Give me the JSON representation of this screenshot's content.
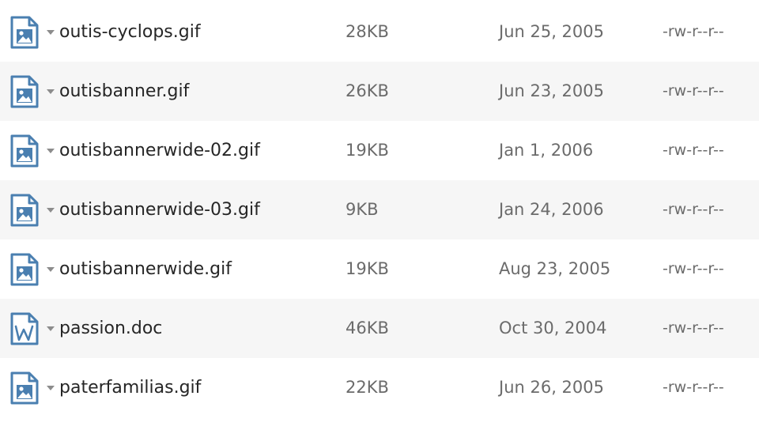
{
  "colors": {
    "icon_blue": "#4a7fb0",
    "row_alt_bg": "#f6f6f6",
    "name_text": "#262626",
    "meta_text": "#6b6b6b"
  },
  "files": [
    {
      "icon": "image-file-icon",
      "name": "outis-cyclops.gif",
      "size": "28KB",
      "date": "Jun 25, 2005",
      "perms": "-rw-r--r--"
    },
    {
      "icon": "image-file-icon",
      "name": "outisbanner.gif",
      "size": "26KB",
      "date": "Jun 23, 2005",
      "perms": "-rw-r--r--"
    },
    {
      "icon": "image-file-icon",
      "name": "outisbannerwide-02.gif",
      "size": "19KB",
      "date": "Jan 1, 2006",
      "perms": "-rw-r--r--"
    },
    {
      "icon": "image-file-icon",
      "name": "outisbannerwide-03.gif",
      "size": "9KB",
      "date": "Jan 24, 2006",
      "perms": "-rw-r--r--"
    },
    {
      "icon": "image-file-icon",
      "name": "outisbannerwide.gif",
      "size": "19KB",
      "date": "Aug 23, 2005",
      "perms": "-rw-r--r--"
    },
    {
      "icon": "word-document-icon",
      "name": "passion.doc",
      "size": "46KB",
      "date": "Oct 30, 2004",
      "perms": "-rw-r--r--"
    },
    {
      "icon": "image-file-icon",
      "name": "paterfamilias.gif",
      "size": "22KB",
      "date": "Jun 26, 2005",
      "perms": "-rw-r--r--"
    }
  ]
}
